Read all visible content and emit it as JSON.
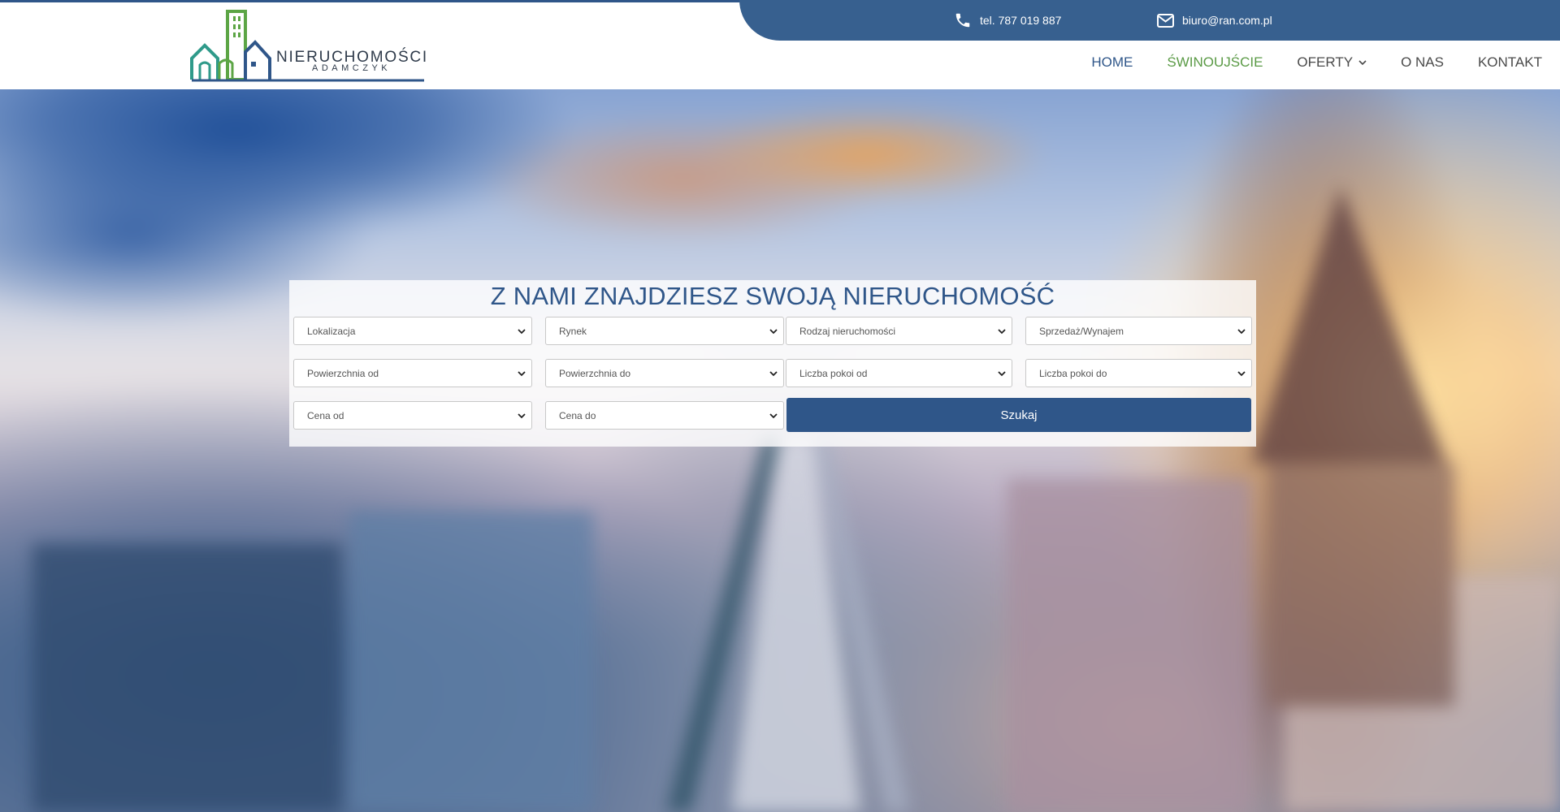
{
  "header": {
    "logo": {
      "title": "NIERUCHOMOŚCI",
      "subtitle": "ADAMCZYK",
      "icon": "buildings-logo-icon",
      "colors": {
        "green": "#5ca545",
        "blue": "#2f5689"
      }
    },
    "contact": {
      "phone_icon": "phone-icon",
      "phone": "tel. 787 019 887",
      "mail_icon": "envelope-icon",
      "email": "biuro@ran.com.pl"
    },
    "nav": {
      "items": [
        {
          "label": "HOME"
        },
        {
          "label": "ŚWINOUJŚCIE"
        },
        {
          "label": "OFERTY"
        },
        {
          "label": "O NAS"
        },
        {
          "label": "KONTAKT"
        }
      ]
    }
  },
  "search": {
    "heading": "Z NAMI ZNAJDZIESZ SWOJĄ NIERUCHOMOŚĆ",
    "fields": {
      "location": "Lokalizacja",
      "market": "Rynek",
      "property_type": "Rodzaj nieruchomości",
      "transaction": "Sprzedaż/Wynajem",
      "area_from": "Powierzchnia od",
      "area_to": "Powierzchnia do",
      "rooms_from": "Liczba pokoi od",
      "rooms_to": "Liczba pokoi do",
      "price_from": "Cena od",
      "price_to": "Cena do"
    },
    "button": "Szukaj"
  },
  "colors": {
    "primary": "#2f5689",
    "contact_bar": "#37608f",
    "nav_active": "#5a9a45",
    "nav_text": "#4a4a4a"
  }
}
